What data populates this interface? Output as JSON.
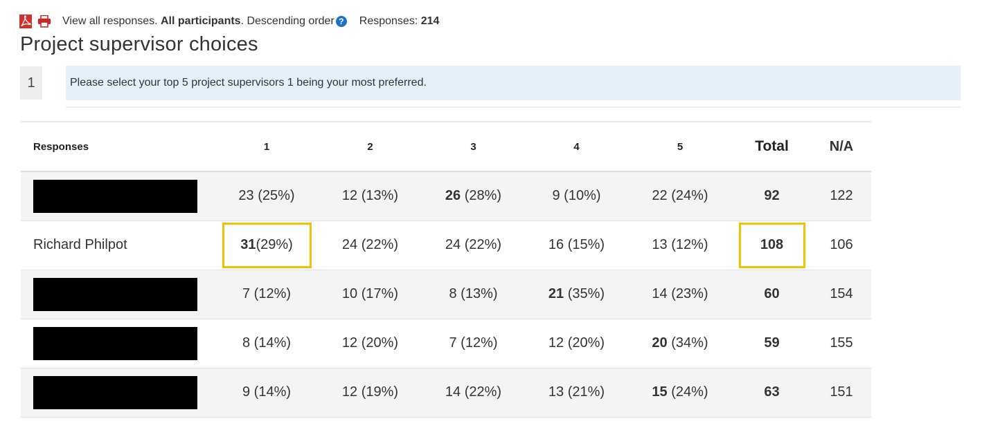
{
  "toolbar": {
    "pdf_icon": "pdf-icon",
    "print_icon": "printer-icon",
    "view_text": "View all responses. ",
    "participants": "All participants",
    "order_text": ". Descending order",
    "help_icon": "?",
    "responses_label": "Responses: ",
    "responses_count": "214"
  },
  "title": "Project supervisor choices",
  "question": {
    "number": "1",
    "text": "Please select your top 5 project supervisors 1 being your most preferred."
  },
  "table": {
    "headers": [
      "Responses",
      "1",
      "2",
      "3",
      "4",
      "5",
      "Total",
      "N/A"
    ],
    "rows": [
      {
        "name": "",
        "redacted": true,
        "c1": {
          "n": "23",
          "p": " (25%)"
        },
        "c2": {
          "n": "12",
          "p": " (13%)"
        },
        "c3": {
          "n": "26",
          "p": " (28%)"
        },
        "c4": {
          "n": "9",
          "p": " (10%)"
        },
        "c5": {
          "n": "22",
          "p": " (24%)"
        },
        "total": "92",
        "na": "122"
      },
      {
        "name": "Richard Philpot",
        "redacted": false,
        "c1": {
          "n": "31",
          "p": " (29%)"
        },
        "c2": {
          "n": "24",
          "p": " (22%)"
        },
        "c3": {
          "n": "24",
          "p": " (22%)"
        },
        "c4": {
          "n": "16",
          "p": " (15%)"
        },
        "c5": {
          "n": "13",
          "p": " (12%)"
        },
        "total": "108",
        "na": "106"
      },
      {
        "name": "",
        "redacted": true,
        "c1": {
          "n": "7",
          "p": " (12%)"
        },
        "c2": {
          "n": "10",
          "p": " (17%)"
        },
        "c3": {
          "n": "8",
          "p": " (13%)"
        },
        "c4": {
          "n": "21",
          "p": " (35%)"
        },
        "c5": {
          "n": "14",
          "p": " (23%)"
        },
        "total": "60",
        "na": "154"
      },
      {
        "name": "",
        "redacted": true,
        "c1": {
          "n": "8",
          "p": " (14%)"
        },
        "c2": {
          "n": "12",
          "p": " (20%)"
        },
        "c3": {
          "n": "7",
          "p": " (12%)"
        },
        "c4": {
          "n": "12",
          "p": " (20%)"
        },
        "c5": {
          "n": "20",
          "p": " (34%)"
        },
        "total": "59",
        "na": "155"
      },
      {
        "name": "",
        "redacted": true,
        "c1": {
          "n": "9",
          "p": " (14%)"
        },
        "c2": {
          "n": "12",
          "p": " (19%)"
        },
        "c3": {
          "n": "14",
          "p": " (22%)"
        },
        "c4": {
          "n": "13",
          "p": " (21%)"
        },
        "c5": {
          "n": "15",
          "p": " (24%)"
        },
        "total": "63",
        "na": "151"
      }
    ]
  },
  "colors": {
    "highlight": "#f2c200",
    "question_bg": "#e3f0fa",
    "help_icon": "#1a73c8",
    "pdf_icon": "#d32f2f"
  }
}
